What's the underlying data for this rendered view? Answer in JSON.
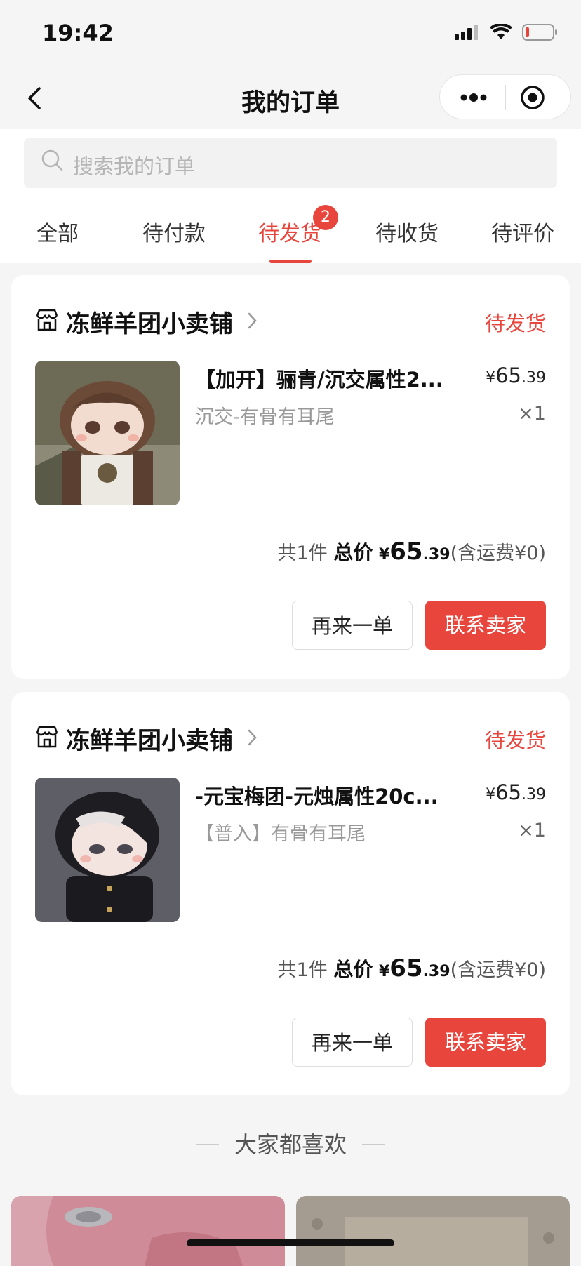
{
  "status_bar": {
    "time": "19:42"
  },
  "nav": {
    "title": "我的订单"
  },
  "search": {
    "placeholder": "搜索我的订单"
  },
  "tabs": [
    {
      "label": "全部"
    },
    {
      "label": "待付款"
    },
    {
      "label": "待发货",
      "active": true,
      "badge": "2"
    },
    {
      "label": "待收货"
    },
    {
      "label": "待评价"
    }
  ],
  "orders": [
    {
      "shop_name": "冻鲜羊团小卖铺",
      "status": "待发货",
      "product_title": "【加开】骊青/沉交属性2...",
      "sku": "沉交-有骨有耳尾",
      "price_yen": "¥",
      "price_int": "65",
      "price_dec": ".39",
      "qty": "×1",
      "count_text": "共1件",
      "total_label": "总价",
      "total_yen": "¥",
      "total_int": "65",
      "total_dec": ".39",
      "shipping": "(含运费¥0)",
      "btn_again": "再来一单",
      "btn_contact": "联系卖家"
    },
    {
      "shop_name": "冻鲜羊团小卖铺",
      "status": "待发货",
      "product_title": "-元宝梅团-元烛属性20c...",
      "sku": "【普入】有骨有耳尾",
      "price_yen": "¥",
      "price_int": "65",
      "price_dec": ".39",
      "qty": "×1",
      "count_text": "共1件",
      "total_label": "总价",
      "total_yen": "¥",
      "total_int": "65",
      "total_dec": ".39",
      "shipping": "(含运费¥0)",
      "btn_again": "再来一单",
      "btn_contact": "联系卖家"
    }
  ],
  "recommend": {
    "title": "大家都喜欢"
  },
  "colors": {
    "accent": "#e8453c",
    "background": "#f5f5f5"
  }
}
